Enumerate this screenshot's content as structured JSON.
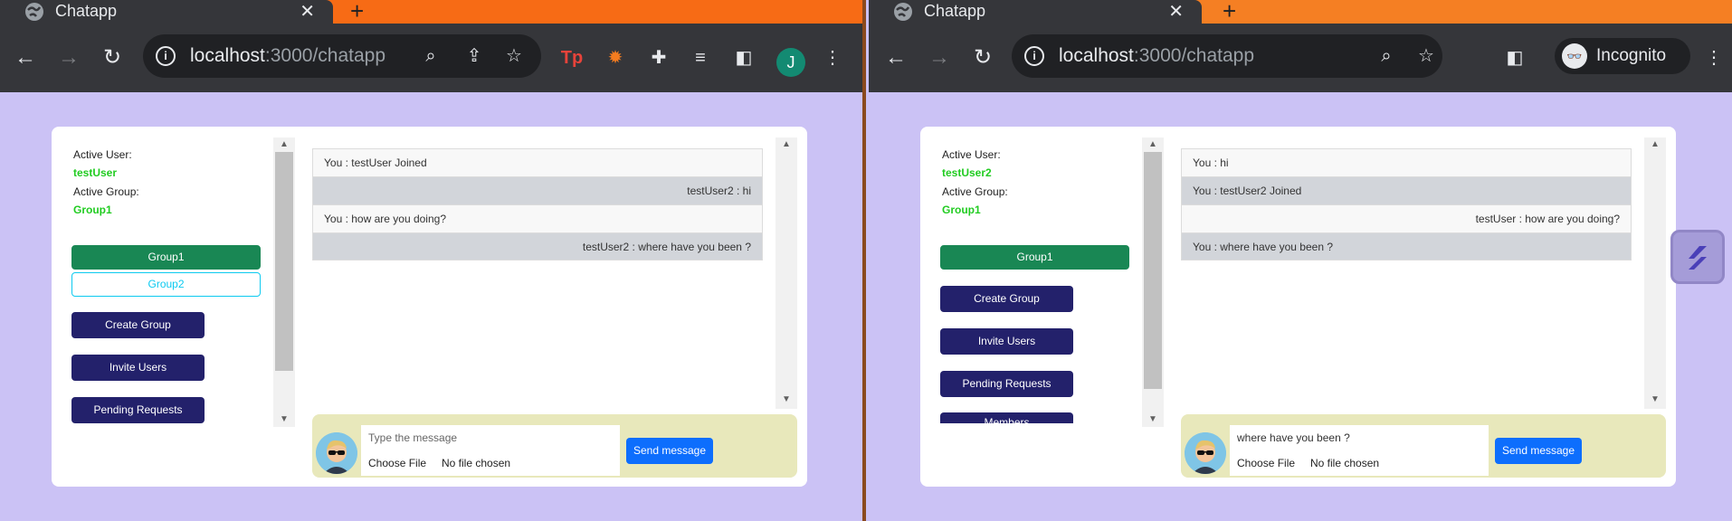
{
  "windows": [
    {
      "tab": {
        "title": "Chatapp"
      },
      "omnibox": {
        "host": "localhost",
        "path": ":3000/chatapp"
      },
      "profile_initial": "J",
      "sidebar": {
        "active_user_label": "Active User:",
        "active_user": "testUser",
        "active_group_label": "Active Group:",
        "active_group": "Group1",
        "groups": [
          "Group1",
          "Group2"
        ],
        "buttons": [
          "Create Group",
          "Invite Users",
          "Pending Requests"
        ]
      },
      "messages": [
        {
          "text": "You : testUser Joined",
          "style": "light",
          "align": "left"
        },
        {
          "text": "testUser2 : hi",
          "style": "dark",
          "align": "right"
        },
        {
          "text": "You : how are you doing?",
          "style": "light",
          "align": "left"
        },
        {
          "text": "testUser2 : where have you been ?",
          "style": "dark",
          "align": "right"
        }
      ],
      "composer": {
        "placeholder": "Type the message",
        "value": "",
        "choose_file": "Choose File",
        "no_file": "No file chosen",
        "send": "Send message"
      }
    },
    {
      "tab": {
        "title": "Chatapp"
      },
      "omnibox": {
        "host": "localhost",
        "path": ":3000/chatapp"
      },
      "incognito_label": "Incognito",
      "sidebar": {
        "active_user_label": "Active User:",
        "active_user": "testUser2",
        "active_group_label": "Active Group:",
        "active_group": "Group1",
        "groups": [
          "Group1"
        ],
        "buttons": [
          "Create Group",
          "Invite Users",
          "Pending Requests",
          "Members"
        ]
      },
      "messages": [
        {
          "text": "You : hi",
          "style": "light",
          "align": "left"
        },
        {
          "text": "You : testUser2 Joined",
          "style": "dark",
          "align": "left"
        },
        {
          "text": "testUser : how are you doing?",
          "style": "light",
          "align": "right"
        },
        {
          "text": "You : where have you been ?",
          "style": "dark",
          "align": "left"
        }
      ],
      "composer": {
        "placeholder": "Type the message",
        "value": "where have you been ?",
        "choose_file": "Choose File",
        "no_file": "No file chosen",
        "send": "Send message"
      }
    }
  ],
  "colors": {
    "page_bg": "#cbc2f5",
    "tab_strip": "#f76b15",
    "active_green": "#198754",
    "nav_button": "#23216b",
    "send_blue": "#0d6efd",
    "composer_bg": "#e8e8bb"
  }
}
